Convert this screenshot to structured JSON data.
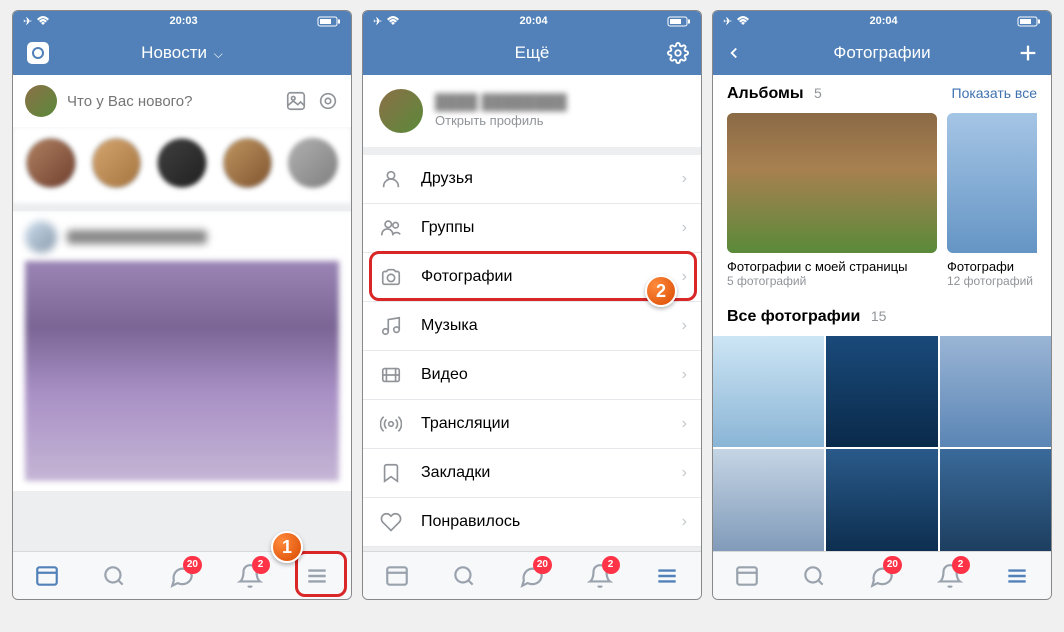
{
  "status": {
    "t1": "20:03",
    "t2": "20:04",
    "t3": "20:04"
  },
  "s1": {
    "title": "Новости",
    "composer_placeholder": "Что у Вас нового?"
  },
  "s2": {
    "title": "Ещё",
    "profile_sub": "Открыть профиль",
    "menu": [
      {
        "label": "Друзья",
        "icon": "user"
      },
      {
        "label": "Группы",
        "icon": "users"
      },
      {
        "label": "Фотографии",
        "icon": "camera"
      },
      {
        "label": "Музыка",
        "icon": "music"
      },
      {
        "label": "Видео",
        "icon": "video"
      },
      {
        "label": "Трансляции",
        "icon": "broadcast"
      },
      {
        "label": "Закладки",
        "icon": "bookmark"
      },
      {
        "label": "Понравилось",
        "icon": "heart"
      }
    ]
  },
  "s3": {
    "title": "Фотографии",
    "albums_title": "Альбомы",
    "albums_count": "5",
    "show_all": "Показать все",
    "album1_name": "Фотографии с моей страницы",
    "album1_sub": "5 фотографий",
    "album2_name": "Фотографи",
    "album2_sub": "12 фотографий",
    "all_title": "Все фотографии",
    "all_count": "15"
  },
  "badges": {
    "msg": "20",
    "notif": "2"
  },
  "callouts": {
    "c1": "1",
    "c2": "2"
  }
}
